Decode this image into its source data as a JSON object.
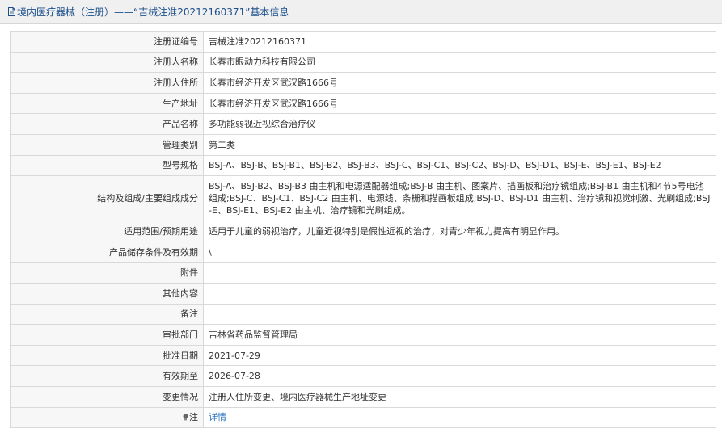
{
  "header": {
    "icon": "document-icon",
    "title": "境内医疗器械（注册）——“吉械注准20212160371”基本信息"
  },
  "rows": [
    {
      "label": "注册证编号",
      "value": "吉械注准20212160371"
    },
    {
      "label": "注册人名称",
      "value": "长春市眼动力科技有限公司"
    },
    {
      "label": "注册人住所",
      "value": "长春市经济开发区武汉路1666号"
    },
    {
      "label": "生产地址",
      "value": "长春市经济开发区武汉路1666号"
    },
    {
      "label": "产品名称",
      "value": "多功能弱视近视综合治疗仪"
    },
    {
      "label": "管理类别",
      "value": "第二类"
    },
    {
      "label": "型号规格",
      "value": "BSJ-A、BSJ-B、BSJ-B1、BSJ-B2、BSJ-B3、BSJ-C、BSJ-C1、BSJ-C2、BSJ-D、BSJ-D1、BSJ-E、BSJ-E1、BSJ-E2"
    },
    {
      "label": "结构及组成/主要组成成分",
      "value": "BSJ-A、BSJ-B2、BSJ-B3 由主机和电源适配器组成;BSJ-B 由主机、图案片、描画板和治疗镜组成;BSJ-B1 由主机和4节5号电池组成;BSJ-C、BSJ-C1、BSJ-C2 由主机、电源线、条栅和描画板组成;BSJ-D、BSJ-D1 由主机、治疗镜和视觉刺激、光刷组成;BSJ-E、BSJ-E1、BSJ-E2 由主机、治疗镜和光刷组成。"
    },
    {
      "label": "适用范围/预期用途",
      "value": "适用于儿童的弱视治疗，儿童近视特别是假性近视的治疗，对青少年视力提高有明显作用。"
    },
    {
      "label": "产品储存条件及有效期",
      "value": "\\"
    },
    {
      "label": "附件",
      "value": ""
    },
    {
      "label": "其他内容",
      "value": ""
    },
    {
      "label": "备注",
      "value": ""
    },
    {
      "label": "审批部门",
      "value": "吉林省药品监督管理局"
    },
    {
      "label": "批准日期",
      "value": "2021-07-29"
    },
    {
      "label": "有效期至",
      "value": "2026-07-28"
    },
    {
      "label": "变更情况",
      "value": "注册人住所变更、境内医疗器械生产地址变更"
    }
  ],
  "note_row": {
    "icon": "lightbulb-icon",
    "label": "注",
    "link_label": "详情"
  },
  "colors": {
    "header_text": "#1c4f8c",
    "link": "#2b72c2",
    "label_bg": "#f7f7f7",
    "border": "#d9d9d9"
  }
}
